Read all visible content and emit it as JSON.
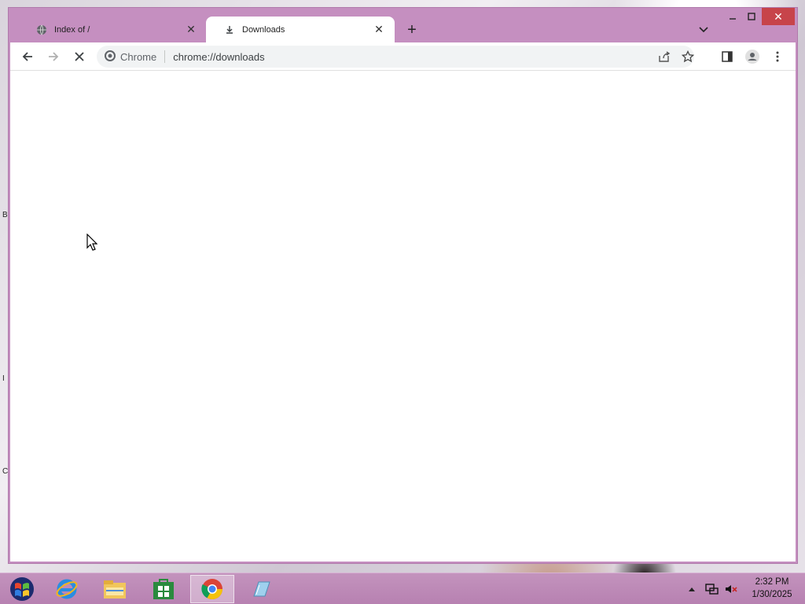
{
  "desktop": {
    "edge_letters": [
      "B",
      "I",
      "C"
    ]
  },
  "browser": {
    "tabs": [
      {
        "label": "Index of /",
        "icon": "globe-icon",
        "active": false
      },
      {
        "label": "Downloads",
        "icon": "download-icon",
        "active": true
      }
    ],
    "new_tab": "+",
    "omnibox": {
      "chip_label": "Chrome",
      "url": "chrome://downloads"
    }
  },
  "taskbar": {
    "apps": [
      "windows-start",
      "internet-explorer",
      "file-explorer",
      "store",
      "chrome",
      "notepad"
    ],
    "clock": {
      "time": "2:32 PM",
      "date": "1/30/2025"
    }
  },
  "colors": {
    "window_frame": "#c58fc0",
    "close_button": "#c7444a",
    "taskbar": "#bc88b6"
  }
}
